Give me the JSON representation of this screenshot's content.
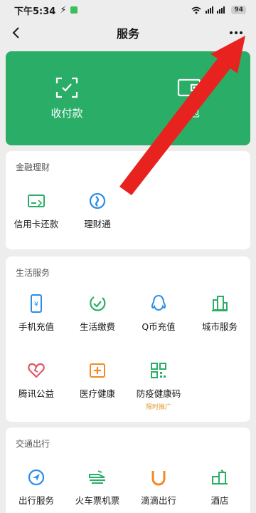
{
  "status_bar": {
    "time": "下午5:34",
    "signal_text": "ııll ııll",
    "battery": "94"
  },
  "nav": {
    "title": "服务"
  },
  "payment": {
    "items": [
      {
        "label": "收付款",
        "icon": "scan-check-icon"
      },
      {
        "label": "钱包",
        "icon": "wallet-icon"
      }
    ]
  },
  "sections": {
    "finance": {
      "title": "金融理财",
      "items": [
        {
          "label": "信用卡还款",
          "icon": "credit-card-icon"
        },
        {
          "label": "理财通",
          "icon": "wealth-icon"
        }
      ]
    },
    "life": {
      "title": "生活服务",
      "items": [
        {
          "label": "手机充值",
          "icon": "phone-recharge-icon"
        },
        {
          "label": "生活缴费",
          "icon": "utility-pay-icon"
        },
        {
          "label": "Q币充值",
          "icon": "qq-coin-icon"
        },
        {
          "label": "城市服务",
          "icon": "city-service-icon"
        },
        {
          "label": "腾讯公益",
          "icon": "charity-heart-icon"
        },
        {
          "label": "医疗健康",
          "icon": "medical-icon"
        },
        {
          "label": "防疫健康码",
          "icon": "qr-code-icon",
          "sub": "限时推广"
        }
      ]
    },
    "transport": {
      "title": "交通出行",
      "items": [
        {
          "label": "出行服务",
          "icon": "navigation-icon"
        },
        {
          "label": "火车票机票",
          "icon": "train-icon"
        },
        {
          "label": "滴滴出行",
          "icon": "didi-icon"
        },
        {
          "label": "酒店",
          "icon": "hotel-icon"
        }
      ]
    }
  },
  "colors": {
    "brand_green": "#2aae67",
    "annotation_red": "#e8231f",
    "promo_orange": "#e09a2a"
  }
}
